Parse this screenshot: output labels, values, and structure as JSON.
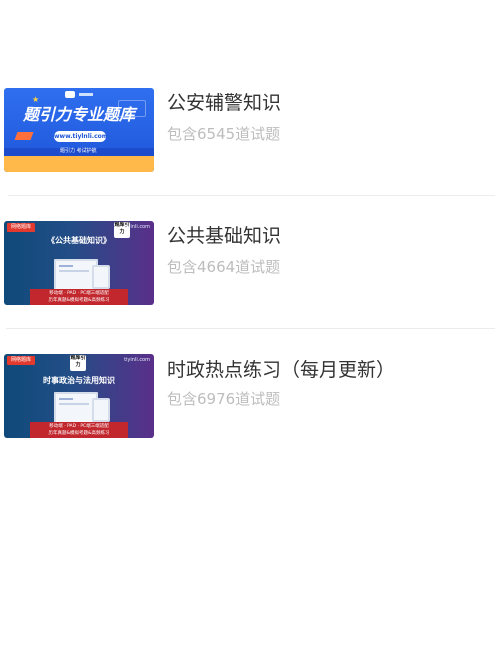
{
  "items": [
    {
      "title": "公安辅警知识",
      "subtitle": "包含6545道试题",
      "thumb": {
        "headline": "题引力专业题库",
        "url": "www.tiylnli.com",
        "tagline": "题引力 考试护航"
      }
    },
    {
      "title": "公共基础知识",
      "subtitle": "包含4664道试题",
      "thumb": {
        "badge": "网络题库",
        "site": "tiyinli.com",
        "logo": "题库引力",
        "heading": "《公共基础知识》",
        "bar_line1": "移动端 · PAD · PC端三端适配",
        "bar_line2": "历年真题&模拟考题&高频练习"
      }
    },
    {
      "title": "时政热点练习（每月更新）",
      "subtitle": "包含6976道试题",
      "thumb": {
        "badge": "网络题库",
        "site": "tiyinli.com",
        "logo": "题库引力",
        "heading": "时事政治与法用知识",
        "bar_line1": "移动端 · PAD · PC端三端适配",
        "bar_line2": "历年真题&模拟考题&高频练习"
      }
    }
  ],
  "colors": {
    "title": "#333333",
    "subtitle": "#bdbdbd",
    "divider": "#ececec",
    "badge": "#e23a2f"
  }
}
